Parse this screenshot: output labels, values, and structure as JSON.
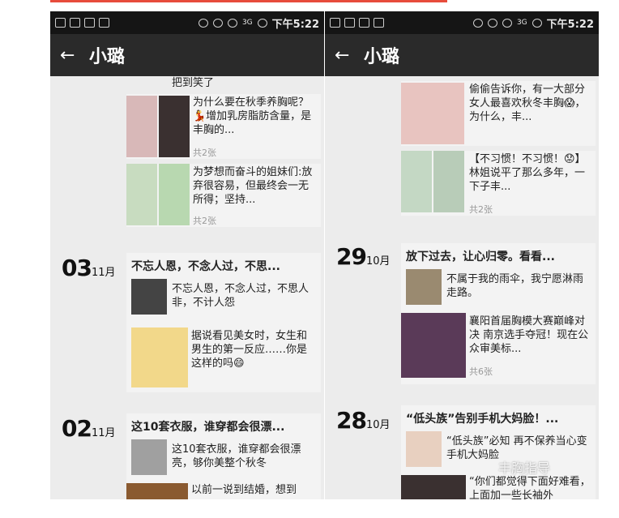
{
  "status_bar": {
    "time": "下午5:22",
    "network": "3G"
  },
  "left_screen": {
    "title": "小璐",
    "top_partial_text": "把到笑了",
    "feed": [
      {
        "text": "为什么要在秋季养胸呢？💃增加乳房脂肪含量，是丰胸的...",
        "count": "共2张"
      },
      {
        "text": "为梦想而奋斗的姐妹们:放弃很容易，但最终会一无所得；坚持...",
        "count": "共2张"
      }
    ],
    "date_groups": [
      {
        "day": "03",
        "month": "11月",
        "headline": "不忘人恩，不念人过，不思...",
        "items": [
          {
            "text": "不忘人恩，不念人过，不思人非，不计人怨"
          },
          {
            "text": "据说看见美女时，女生和男生的第一反应……你是这样的吗😄"
          }
        ]
      },
      {
        "day": "02",
        "month": "11月",
        "headline": "这10套衣服，谁穿都会很漂...",
        "items": [
          {
            "text": "这10套衣服，谁穿都会很漂亮，够你美整个秋冬"
          },
          {
            "text": "以前一说到结婚，想到"
          }
        ]
      }
    ]
  },
  "right_screen": {
    "title": "小璐",
    "feed": [
      {
        "text": "偷偷告诉你，有一大部分女人最喜欢秋冬丰胸😱，为什么，丰...",
        "count": ""
      },
      {
        "text": "【不习惯！不习惯！😟】林姐说平了那么多年，一下子丰...",
        "count": "共2张"
      }
    ],
    "date_groups": [
      {
        "day": "29",
        "month": "10月",
        "headline": "放下过去，让心归零。看看...",
        "items": [
          {
            "text": "不属于我的雨伞，我宁愿淋雨走路。"
          },
          {
            "text": "襄阳首届胸模大赛巅峰对决 南京选手夺冠！现在公众审美标...",
            "count": "共6张"
          }
        ]
      },
      {
        "day": "28",
        "month": "10月",
        "headline": "“低头族”告别手机大妈脸！...",
        "items": [
          {
            "text": "“低头族”必知 再不保养当心变手机大妈脸"
          },
          {
            "text": "“你们都觉得下面好难看，上面加一些长袖外"
          }
        ]
      }
    ],
    "watermark": "丰胸指导"
  }
}
